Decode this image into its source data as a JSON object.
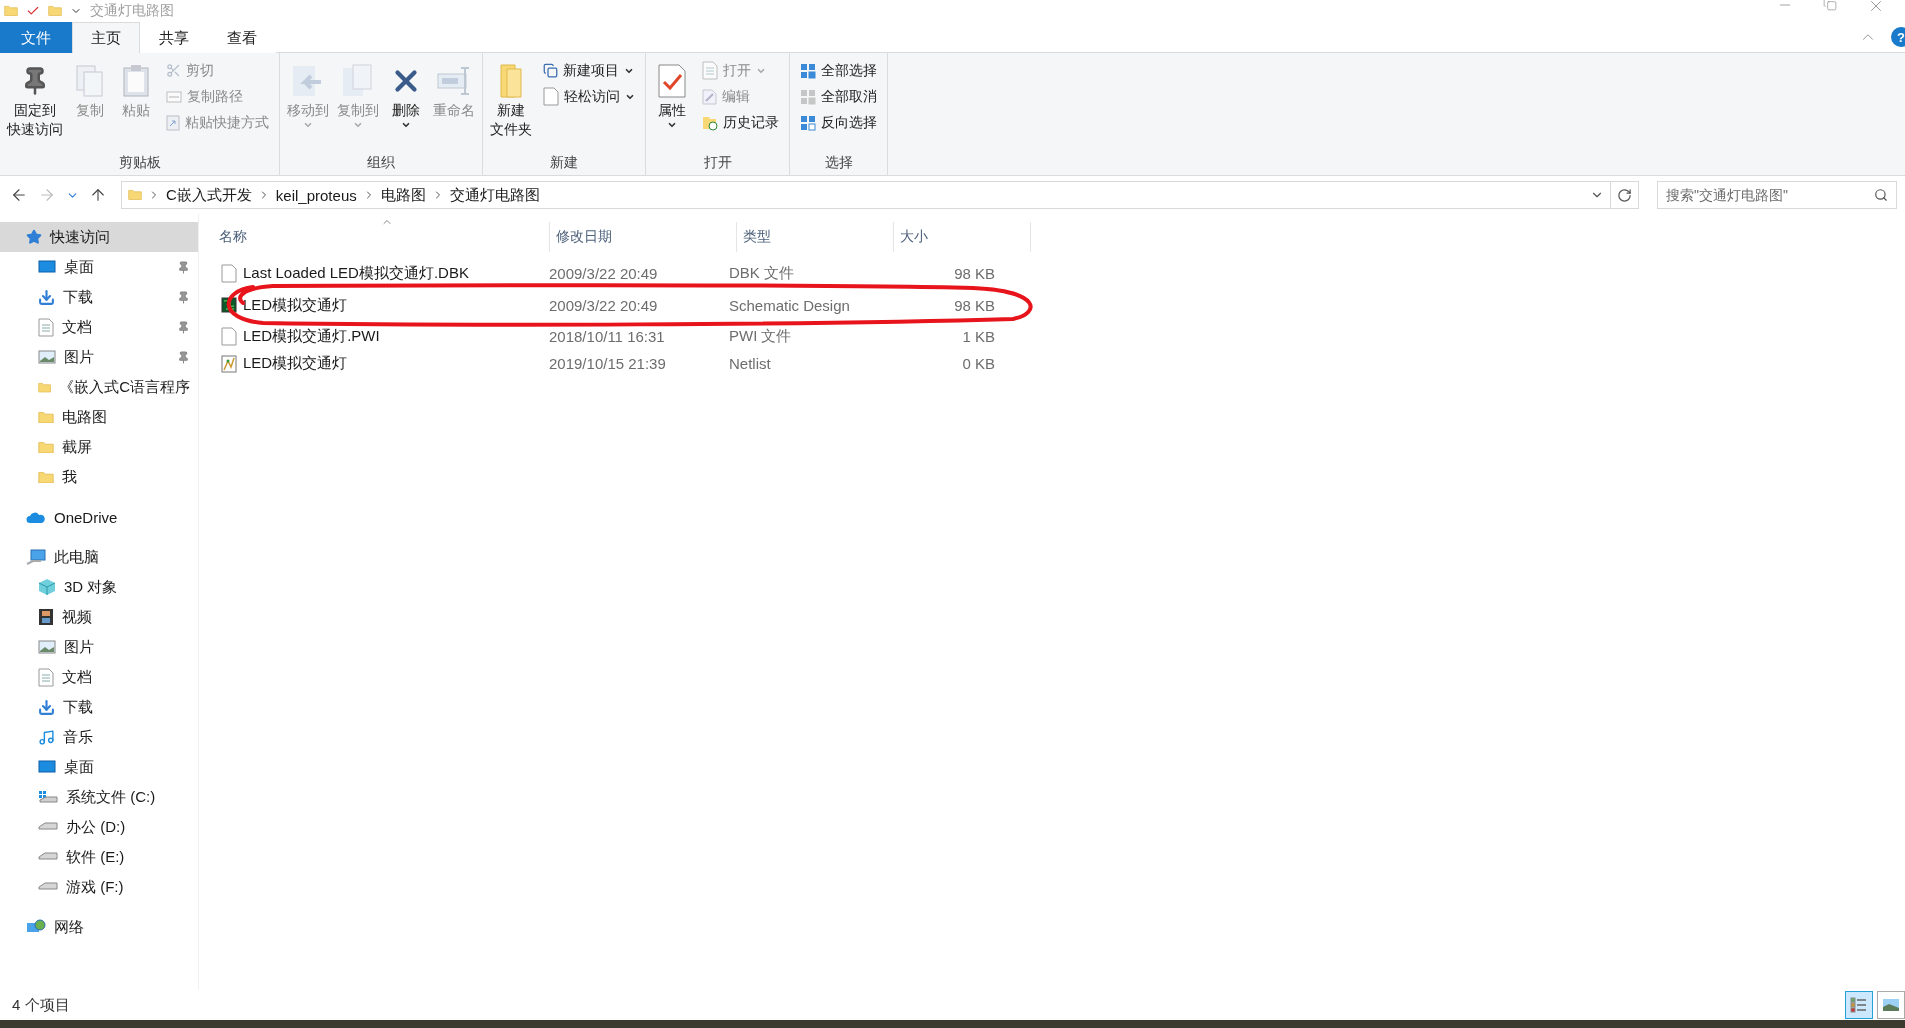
{
  "window": {
    "title": "交通灯电路图"
  },
  "ribbon_tabs": [
    {
      "label": "文件",
      "kind": "file",
      "selected": false
    },
    {
      "label": "主页",
      "kind": "tab",
      "selected": true
    },
    {
      "label": "共享",
      "kind": "tab",
      "selected": false
    },
    {
      "label": "查看",
      "kind": "tab",
      "selected": false
    }
  ],
  "help_button": {
    "label": "?"
  },
  "ribbon_groups": [
    {
      "label": "剪贴板",
      "large": [
        {
          "lines": [
            "固定到",
            "快速访问"
          ],
          "disabled": false,
          "has_menu": false
        },
        {
          "lines": [
            "复制"
          ],
          "disabled": true,
          "has_menu": false
        },
        {
          "lines": [
            "粘贴"
          ],
          "disabled": true,
          "has_menu": false
        }
      ],
      "small": [
        {
          "label": "剪切",
          "disabled": true,
          "has_menu": false
        },
        {
          "label": "复制路径",
          "disabled": true,
          "has_menu": false
        },
        {
          "label": "粘贴快捷方式",
          "disabled": true,
          "has_menu": false
        }
      ]
    },
    {
      "label": "组织",
      "large": [
        {
          "lines": [
            "移动到"
          ],
          "disabled": true,
          "has_menu": true
        },
        {
          "lines": [
            "复制到"
          ],
          "disabled": true,
          "has_menu": true
        },
        {
          "lines": [
            "删除"
          ],
          "disabled": false,
          "has_menu": true
        },
        {
          "lines": [
            "重命名"
          ],
          "disabled": true,
          "has_menu": false
        }
      ]
    },
    {
      "label": "新建",
      "large": [
        {
          "lines": [
            "新建",
            "文件夹"
          ],
          "disabled": false,
          "has_menu": false
        }
      ],
      "small": [
        {
          "label": "新建项目",
          "disabled": false,
          "has_menu": true
        },
        {
          "label": "轻松访问",
          "disabled": false,
          "has_menu": true
        }
      ]
    },
    {
      "label": "打开",
      "large": [
        {
          "lines": [
            "属性"
          ],
          "disabled": false,
          "has_menu": true
        }
      ],
      "small": [
        {
          "label": "打开",
          "disabled": true,
          "has_menu": true
        },
        {
          "label": "编辑",
          "disabled": true,
          "has_menu": false
        },
        {
          "label": "历史记录",
          "disabled": false,
          "has_menu": false
        }
      ]
    },
    {
      "label": "选择",
      "small": [
        {
          "label": "全部选择",
          "disabled": false,
          "has_menu": false
        },
        {
          "label": "全部取消",
          "disabled": false,
          "has_menu": false
        },
        {
          "label": "反向选择",
          "disabled": false,
          "has_menu": false
        }
      ]
    }
  ],
  "address_bar": {
    "path": [
      "C嵌入式开发",
      "keil_proteus",
      "电路图",
      "交通灯电路图"
    ]
  },
  "search": {
    "placeholder": "搜索\"交通灯电路图\""
  },
  "navigation": [
    {
      "label": "快速访问",
      "kind": "star",
      "selected": true,
      "children": [
        {
          "label": "桌面",
          "kind": "desktop",
          "pinned": true,
          "selected": false
        },
        {
          "label": "下载",
          "kind": "download",
          "pinned": true,
          "selected": false
        },
        {
          "label": "文档",
          "kind": "document",
          "pinned": true,
          "selected": false
        },
        {
          "label": "图片",
          "kind": "picture",
          "pinned": true,
          "selected": false
        },
        {
          "label": "《嵌入式C语言程序",
          "kind": "folder",
          "pinned": false,
          "selected": false
        },
        {
          "label": "电路图",
          "kind": "folder",
          "pinned": false,
          "selected": false
        },
        {
          "label": "截屏",
          "kind": "folder",
          "pinned": false,
          "selected": false
        },
        {
          "label": "我",
          "kind": "folder",
          "pinned": false,
          "selected": false
        }
      ]
    },
    {
      "label": "OneDrive",
      "kind": "cloud",
      "selected": false
    },
    {
      "label": "此电脑",
      "kind": "pc",
      "selected": false,
      "children": [
        {
          "label": "3D 对象",
          "kind": "cube",
          "pinned": false,
          "selected": false
        },
        {
          "label": "视频",
          "kind": "video",
          "pinned": false,
          "selected": false
        },
        {
          "label": "图片",
          "kind": "picture",
          "pinned": false,
          "selected": false
        },
        {
          "label": "文档",
          "kind": "document",
          "pinned": false,
          "selected": false
        },
        {
          "label": "下载",
          "kind": "download",
          "pinned": false,
          "selected": false
        },
        {
          "label": "音乐",
          "kind": "music",
          "pinned": false,
          "selected": false
        },
        {
          "label": "桌面",
          "kind": "desktop",
          "pinned": false,
          "selected": false
        },
        {
          "label": "系统文件 (C:)",
          "kind": "system-drive",
          "pinned": false,
          "selected": false
        },
        {
          "label": "办公 (D:)",
          "kind": "drive",
          "pinned": false,
          "selected": false
        },
        {
          "label": "软件 (E:)",
          "kind": "drive",
          "pinned": false,
          "selected": false
        },
        {
          "label": "游戏 (F:)",
          "kind": "drive",
          "pinned": false,
          "selected": false
        }
      ]
    },
    {
      "label": "网络",
      "kind": "network",
      "selected": false
    }
  ],
  "table": {
    "columns": [
      {
        "label": "名称",
        "sorted": true
      },
      {
        "label": "修改日期",
        "sorted": false
      },
      {
        "label": "类型",
        "sorted": false
      },
      {
        "label": "大小",
        "sorted": false
      }
    ],
    "rows": [
      {
        "name": "Last Loaded LED模拟交通灯.DBK",
        "date": "2009/3/22 20:49",
        "type": "DBK 文件",
        "size": "98 KB",
        "kind": "blank",
        "selected": false,
        "circled": false
      },
      {
        "name": "LED模拟交通灯",
        "date": "2009/3/22 20:49",
        "type": "Schematic Design",
        "size": "98 KB",
        "kind": "schematic",
        "selected": false,
        "circled": true
      },
      {
        "name": "LED模拟交通灯.PWI",
        "date": "2018/10/11 16:31",
        "type": "PWI 文件",
        "size": "1 KB",
        "kind": "blank",
        "selected": false,
        "circled": false
      },
      {
        "name": "LED模拟交通灯",
        "date": "2019/10/15 21:39",
        "type": "Netlist",
        "size": "0 KB",
        "kind": "netlist",
        "selected": false,
        "circled": false
      }
    ]
  },
  "status_bar": {
    "item_count": "4 个项目"
  },
  "view_buttons": [
    {
      "kind": "details",
      "selected": true
    },
    {
      "kind": "large-icons",
      "selected": false
    }
  ]
}
